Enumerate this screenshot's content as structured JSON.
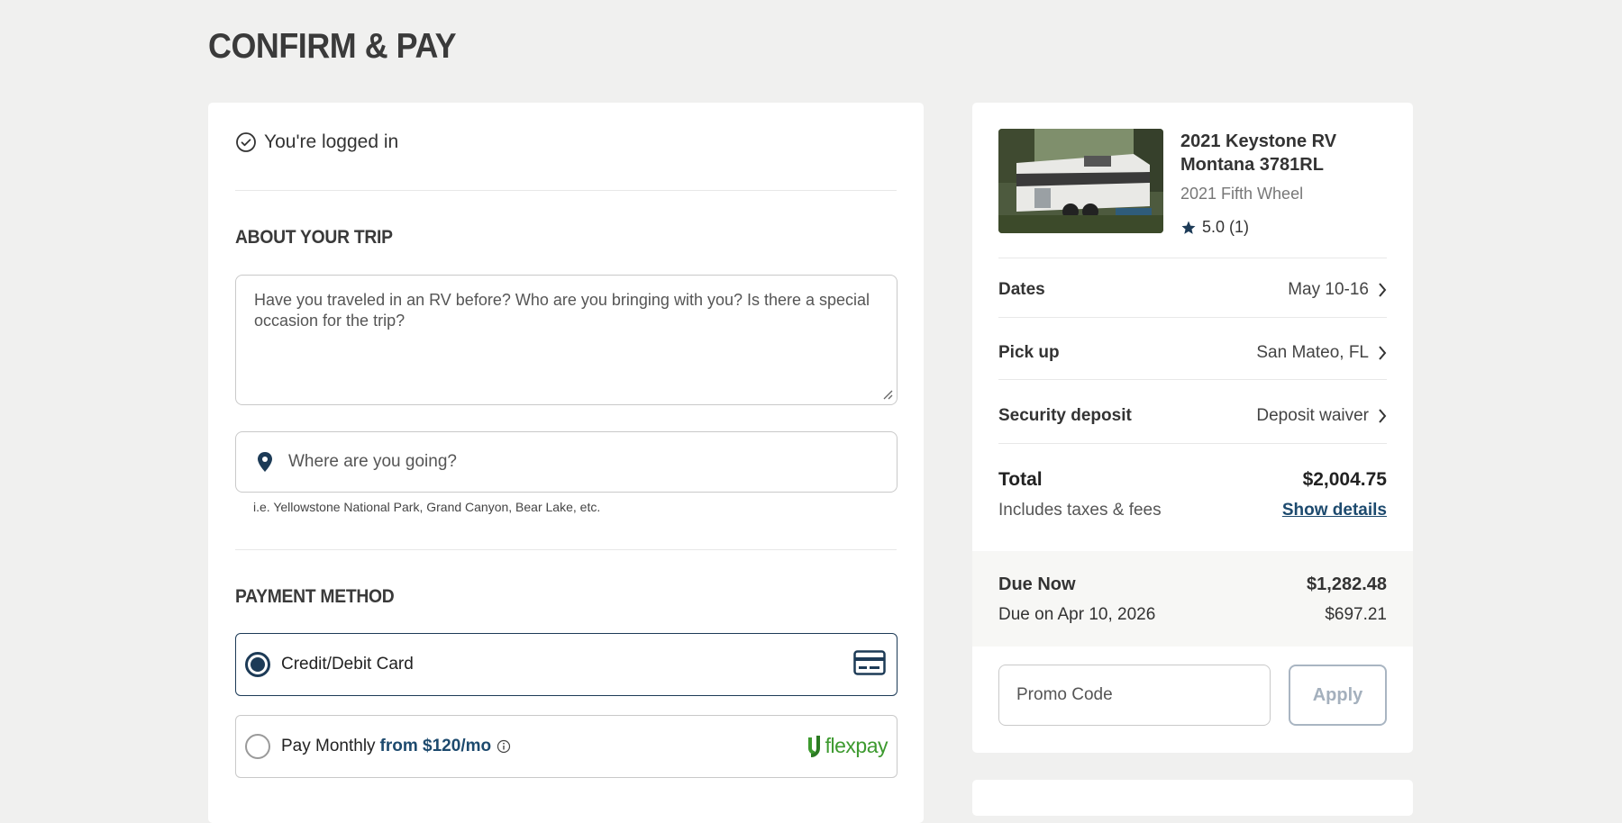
{
  "page": {
    "title": "CONFIRM & PAY"
  },
  "login": {
    "status": "You're logged in"
  },
  "trip": {
    "heading": "ABOUT YOUR TRIP",
    "notes_placeholder": "Have you traveled in an RV before? Who are you bringing with you? Is there a special occasion for the trip?",
    "destination_placeholder": "Where are you going?",
    "destination_hint": "i.e. Yellowstone National Park, Grand Canyon, Bear Lake, etc."
  },
  "payment": {
    "heading": "PAYMENT METHOD",
    "options": [
      {
        "label": "Credit/Debit Card",
        "selected": true,
        "icon": "credit-card-icon"
      },
      {
        "label": "Pay Monthly",
        "accent": "from $120/mo",
        "selected": false,
        "icon": "flexpay-logo",
        "logo_text": "flexpay"
      }
    ]
  },
  "listing": {
    "title": "2021 Keystone RV Montana 3781RL",
    "subtitle": "2021 Fifth Wheel",
    "rating": "5.0 (1)"
  },
  "summary": {
    "rows": [
      {
        "label": "Dates",
        "value": "May 10-16"
      },
      {
        "label": "Pick up",
        "value": "San Mateo, FL"
      },
      {
        "label": "Security deposit",
        "value": "Deposit waiver"
      }
    ],
    "total_label": "Total",
    "total_value": "$2,004.75",
    "taxes_note": "Includes taxes & fees",
    "details_link": "Show details",
    "due_now_label": "Due Now",
    "due_now_value": "$1,282.48",
    "due_later_label": "Due on Apr 10, 2026",
    "due_later_value": "$697.21"
  },
  "promo": {
    "placeholder": "Promo Code",
    "apply_label": "Apply"
  },
  "colors": {
    "primary": "#1d3b57",
    "flexpay": "#3d9a2f",
    "background": "#f0f0ef"
  }
}
